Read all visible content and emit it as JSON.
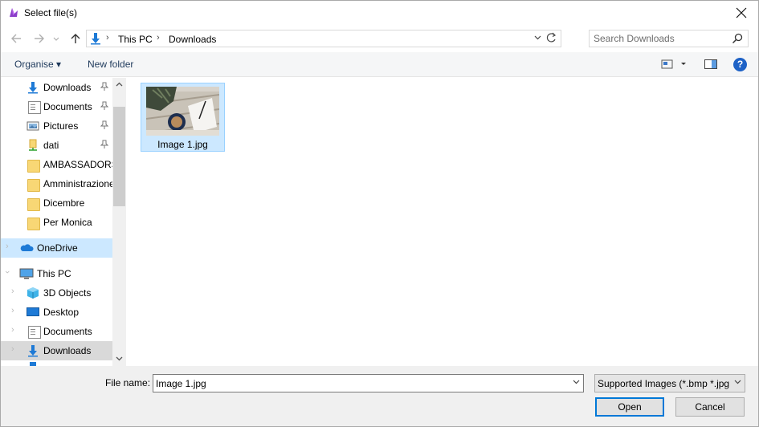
{
  "window": {
    "title": "Select file(s)"
  },
  "toolbar": {
    "back_icon": "arrow-left-icon",
    "forward_icon": "arrow-right-icon",
    "recent_icon": "chevron-down-icon",
    "up_icon": "arrow-up-icon"
  },
  "address": {
    "crumbs": [
      "This PC",
      "Downloads"
    ]
  },
  "search": {
    "placeholder": "Search Downloads"
  },
  "commands": {
    "organise": "Organise",
    "organise_arrow": "▾",
    "new_folder": "New folder",
    "help": "?"
  },
  "nav": {
    "quick_access": [
      {
        "label": "Downloads",
        "icon": "download-arrow-icon",
        "pinned": true
      },
      {
        "label": "Documents",
        "icon": "document-icon",
        "pinned": true
      },
      {
        "label": "Pictures",
        "icon": "pictures-icon",
        "pinned": true
      },
      {
        "label": "dati",
        "icon": "network-drive-icon",
        "pinned": true
      },
      {
        "label": "AMBASSADORS",
        "icon": "folder-icon",
        "pinned": false
      },
      {
        "label": "Amministrazione",
        "icon": "folder-icon",
        "pinned": false
      },
      {
        "label": "Dicembre",
        "icon": "folder-icon",
        "pinned": false
      },
      {
        "label": "Per Monica",
        "icon": "folder-icon",
        "pinned": false
      }
    ],
    "onedrive": "OneDrive",
    "this_pc": "This PC",
    "this_pc_items": [
      {
        "label": "3D Objects",
        "icon": "cube-icon"
      },
      {
        "label": "Desktop",
        "icon": "desktop-icon"
      },
      {
        "label": "Documents",
        "icon": "document-icon"
      },
      {
        "label": "Downloads",
        "icon": "download-arrow-icon"
      }
    ],
    "pin_glyph": "📌"
  },
  "files": [
    {
      "name": "Image 1.jpg",
      "selected": true
    }
  ],
  "bottom": {
    "file_name_label": "File name:",
    "file_name_value": "Image 1.jpg",
    "filter_value": "Supported Images (*.bmp *.jpg",
    "open_label": "Open",
    "cancel_label": "Cancel"
  },
  "colors": {
    "selection": "#cce8ff",
    "accent": "#0078d7",
    "folder": "#f8d775",
    "link": "#1e395b"
  }
}
